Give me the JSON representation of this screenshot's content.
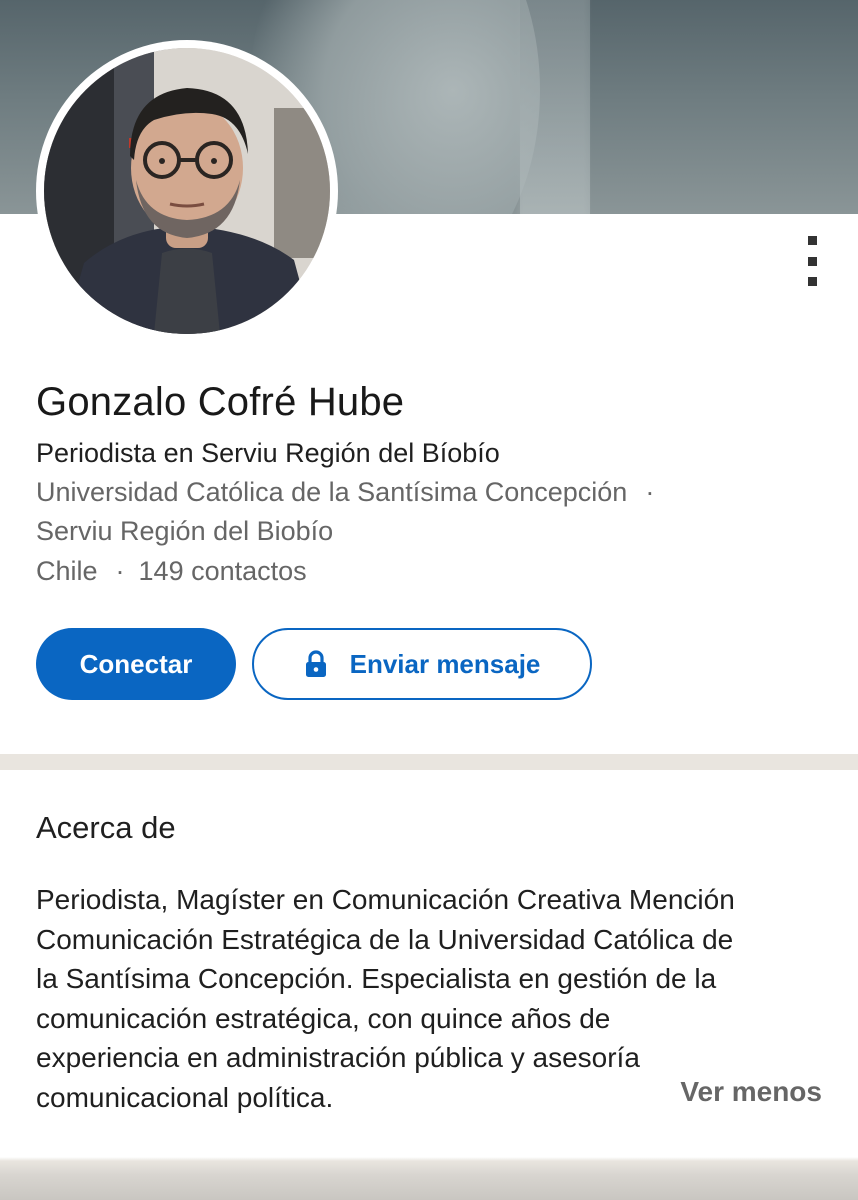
{
  "profile": {
    "name": "Gonzalo Cofré Hube",
    "headline": "Periodista en Serviu Región del Bíobío",
    "education_line1": "Universidad Católica de la Santísima Concepción",
    "separator": "·",
    "education_line2": "Serviu Región del Biobío",
    "location": "Chile",
    "connections": "149 contactos"
  },
  "actions": {
    "connect_label": "Conectar",
    "message_label": "Enviar mensaje"
  },
  "about": {
    "title": "Acerca de",
    "lines": [
      "Periodista, Magíster en Comunicación Creativa Mención",
      "Comunicación Estratégica de la Universidad Católica de",
      "la Santísima Concepción. Especialista en gestión de la",
      "comunicación estratégica, con quince años de",
      "experiencia en administración pública y asesoría",
      "comunicacional política."
    ],
    "see_less_label": "Ver menos"
  },
  "icons": {
    "menu": "more-vertical-icon",
    "lock": "lock-icon"
  },
  "colors": {
    "accent": "#0a66c2",
    "secondary_text": "#666666",
    "section_separator": "#e9e5df"
  }
}
